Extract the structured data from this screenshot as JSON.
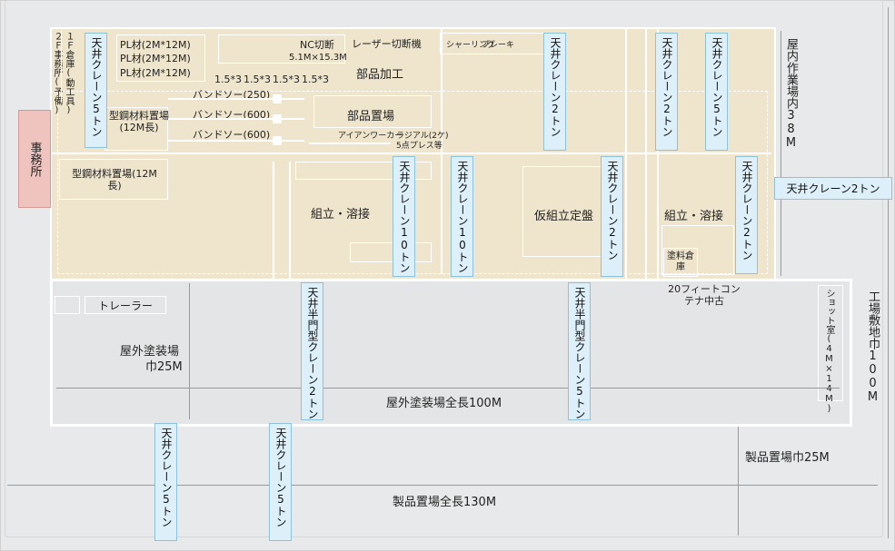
{
  "office_label": "事務所",
  "upstairs_office": "２Ｆ事務所(予備)",
  "warehouse_label": "１Ｆ倉庫(動工具)",
  "pl_materials": [
    "PL材(2M*12M)",
    "PL材(2M*12M)",
    "PL材(2M*12M)"
  ],
  "nc_cutting": "NC切断",
  "nc_size": "5.1M×15.3M",
  "laser_cutting": "レーザー切断機",
  "shearing": "シャーリング",
  "brake": "ブレーキ",
  "thickness_values": [
    "1.5*3",
    "1.5*3",
    "1.5*3",
    "1.5*3"
  ],
  "parts_processing": "部品加工",
  "bandsaws": [
    "バンドソー(250)",
    "バンドソー(600)",
    "バンドソー(600)"
  ],
  "steel_storage_upper": "型鋼材料置場(12M長)",
  "steel_storage_lower": "型鋼材料置場(12M長)",
  "parts_storage": "部品置場",
  "ironworker": "アイアンワーカー",
  "radial": "ラジアル(2ケ)",
  "press": "5点プレス等",
  "assembly_welding": "組立・溶接",
  "temp_assembly": "仮組立定盤",
  "assembly_welding_2": "組立・溶接",
  "paint_storage": "塗料倉庫",
  "container": "20フィートコンテナ中古",
  "trailer": "トレーラー",
  "outdoor_painting": "屋外塗装場",
  "outdoor_width": "巾25M",
  "outdoor_length": "屋外塗装場全長100M",
  "shot_room": "ショット室(4M×14M)",
  "indoor_width": "屋内作業場内38M",
  "site_width": "工場敷地巾100M",
  "product_storage_width": "製品置場巾25M",
  "product_storage_length": "製品置場全長130M",
  "cranes": {
    "c1": "天井クレーン5トン",
    "c2": "天井クレーン2トン",
    "c3": "天井クレーン2トン",
    "c4": "天井クレーン5トン",
    "c5": "天井クレーン10トン",
    "c6": "天井クレーン10トン",
    "c7": "天井クレーン2トン",
    "c8": "天井クレーン2トン",
    "c9": "天井クレーン2トン",
    "c10": "天井半門型クレーン2トン",
    "c11": "天井半門型クレーン5トン",
    "c12": "天井クレーン5トン",
    "c13": "天井クレーン5トン"
  },
  "colors": {
    "indoor": "#efe4cc",
    "office": "#efc4bf",
    "crane": "#ddeff8",
    "outdoor": "#e4e5e6"
  }
}
